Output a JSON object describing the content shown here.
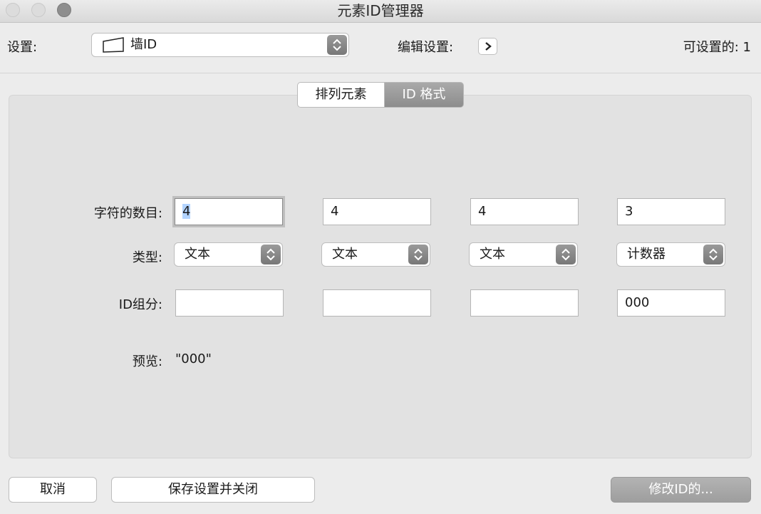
{
  "window": {
    "title": "元素ID管理器"
  },
  "toolbar": {
    "settings_label": "设置:",
    "settings_value": "墙ID",
    "settings_icon": "wall-outline-icon",
    "edit_settings_label": "编辑设置:",
    "settable_label": "可设置的: 1"
  },
  "tabs": [
    {
      "label": "排列元素",
      "active": false
    },
    {
      "label": "ID 格式",
      "active": true
    }
  ],
  "form": {
    "char_count_label": "字符的数目:",
    "type_label": "类型:",
    "id_group_label": "ID组分:",
    "preview_label": "预览:",
    "preview_value": "\"000\"",
    "columns": [
      {
        "char_count": "4",
        "type": "文本",
        "id_group": ""
      },
      {
        "char_count": "4",
        "type": "文本",
        "id_group": ""
      },
      {
        "char_count": "4",
        "type": "文本",
        "id_group": ""
      },
      {
        "char_count": "3",
        "type": "计数器",
        "id_group": "000"
      }
    ]
  },
  "buttons": {
    "cancel": "取消",
    "save_close": "保存设置并关闭",
    "modify_ids": "修改ID的..."
  }
}
